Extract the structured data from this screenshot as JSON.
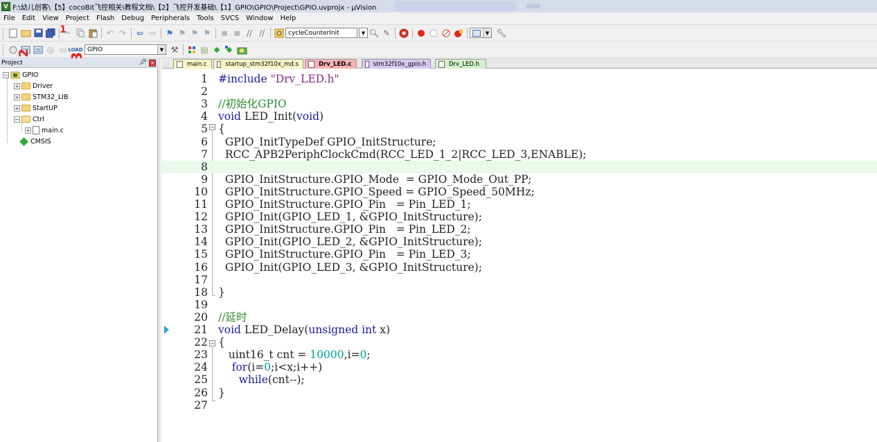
{
  "window": {
    "title": "F:\\幼儿创客\\【5】cocoBit飞控相关\\教程文档\\【2】飞控开发基础\\【1】GPIO\\GPIO\\Project\\GPIO.uvprojx - µVision"
  },
  "menu": [
    "File",
    "Edit",
    "View",
    "Project",
    "Flash",
    "Debug",
    "Peripherals",
    "Tools",
    "SVCS",
    "Window",
    "Help"
  ],
  "toolbar1": {
    "function_combo": "cycleCounterInit"
  },
  "toolbar2": {
    "target_combo": "GPIO"
  },
  "annotations": [
    "1",
    "2",
    "3"
  ],
  "project_panel": {
    "title": "Project",
    "tree": [
      {
        "label": "GPIO",
        "level": 0,
        "type": "target"
      },
      {
        "label": "Driver",
        "level": 1,
        "type": "folder"
      },
      {
        "label": "STM32_LIB",
        "level": 1,
        "type": "folder"
      },
      {
        "label": "StartUP",
        "level": 1,
        "type": "folder"
      },
      {
        "label": "Ctrl",
        "level": 1,
        "type": "folder-open"
      },
      {
        "label": "main.c",
        "level": 2,
        "type": "file"
      },
      {
        "label": "CMSIS",
        "level": 1,
        "type": "component"
      }
    ]
  },
  "tabs": [
    {
      "label": "main.c",
      "color": "#fbf3c4",
      "active": false
    },
    {
      "label": "startup_stm32f10x_md.s",
      "color": "#fbf3c4",
      "active": false
    },
    {
      "label": "Drv_LED.c",
      "color": "#f6b2b2",
      "active": true
    },
    {
      "label": "stm32f10x_gpio.h",
      "color": "#d9c6f0",
      "active": false
    },
    {
      "label": "Drv_LED.h",
      "color": "#d3f0c8",
      "active": false
    }
  ],
  "editor": {
    "highlight_line": 8,
    "current_line_marker": 21,
    "lines": [
      {
        "n": "1",
        "parts": [
          [
            "kw",
            "#include "
          ],
          [
            "str",
            "\"Drv_LED.h\""
          ]
        ]
      },
      {
        "n": "2",
        "parts": []
      },
      {
        "n": "3",
        "parts": [
          [
            "cm",
            "//初始化GPIO"
          ]
        ]
      },
      {
        "n": "4",
        "parts": [
          [
            "kw",
            "void"
          ],
          [
            "",
            " LED_Init("
          ],
          [
            "kw",
            "void"
          ],
          [
            "",
            ")"
          ]
        ]
      },
      {
        "n": "5",
        "parts": [
          [
            "",
            "{"
          ]
        ]
      },
      {
        "n": "6",
        "parts": [
          [
            "",
            "  GPIO_InitTypeDef GPIO_InitStructure;"
          ]
        ]
      },
      {
        "n": "7",
        "parts": [
          [
            "",
            "  RCC_APB2PeriphClockCmd(RCC_LED_1_2|RCC_LED_3,ENABLE);"
          ]
        ]
      },
      {
        "n": "8",
        "parts": []
      },
      {
        "n": "9",
        "parts": [
          [
            "",
            "  GPIO_InitStructure.GPIO_Mode  = GPIO_Mode_Out_PP;"
          ]
        ]
      },
      {
        "n": "10",
        "parts": [
          [
            "",
            "  GPIO_InitStructure.GPIO_Speed = GPIO_Speed_50MHz;"
          ]
        ]
      },
      {
        "n": "11",
        "parts": [
          [
            "",
            "  GPIO_InitStructure.GPIO_Pin   = Pin_LED_1;"
          ]
        ]
      },
      {
        "n": "12",
        "parts": [
          [
            "",
            "  GPIO_Init(GPIO_LED_1, &GPIO_InitStructure);"
          ]
        ]
      },
      {
        "n": "13",
        "parts": [
          [
            "",
            "  GPIO_InitStructure.GPIO_Pin   = Pin_LED_2;"
          ]
        ]
      },
      {
        "n": "14",
        "parts": [
          [
            "",
            "  GPIO_Init(GPIO_LED_2, &GPIO_InitStructure);"
          ]
        ]
      },
      {
        "n": "15",
        "parts": [
          [
            "",
            "  GPIO_InitStructure.GPIO_Pin   = Pin_LED_3;"
          ]
        ]
      },
      {
        "n": "16",
        "parts": [
          [
            "",
            "  GPIO_Init(GPIO_LED_3, &GPIO_InitStructure);"
          ]
        ]
      },
      {
        "n": "17",
        "parts": []
      },
      {
        "n": "18",
        "parts": [
          [
            "",
            "}"
          ]
        ]
      },
      {
        "n": "19",
        "parts": []
      },
      {
        "n": "20",
        "parts": [
          [
            "cm",
            "//延时"
          ]
        ]
      },
      {
        "n": "21",
        "parts": [
          [
            "kw",
            "void"
          ],
          [
            "",
            " LED_Delay("
          ],
          [
            "kw",
            "unsigned int"
          ],
          [
            "",
            " x)"
          ]
        ]
      },
      {
        "n": "22",
        "parts": [
          [
            "",
            "{"
          ]
        ]
      },
      {
        "n": "23",
        "parts": [
          [
            "",
            "   uint16_t cnt = "
          ],
          [
            "num",
            "10000"
          ],
          [
            "",
            ",i="
          ],
          [
            "num",
            "0"
          ],
          [
            "",
            ";"
          ]
        ]
      },
      {
        "n": "24",
        "parts": [
          [
            "",
            "    "
          ],
          [
            "kw",
            "for"
          ],
          [
            "",
            "(i="
          ],
          [
            "num",
            "0"
          ],
          [
            "",
            ";i<x;i++)"
          ]
        ]
      },
      {
        "n": "25",
        "parts": [
          [
            "",
            "      "
          ],
          [
            "kw",
            "while"
          ],
          [
            "",
            "(cnt--);"
          ]
        ]
      },
      {
        "n": "26",
        "parts": [
          [
            "",
            "}"
          ]
        ]
      },
      {
        "n": "27",
        "parts": []
      }
    ]
  },
  "colors": {
    "keyword": "#1a1aa6",
    "comment": "#2e8b2e",
    "number": "#00a0a0",
    "string": "#8a2a8a",
    "annotation_red": "#e0261b"
  }
}
